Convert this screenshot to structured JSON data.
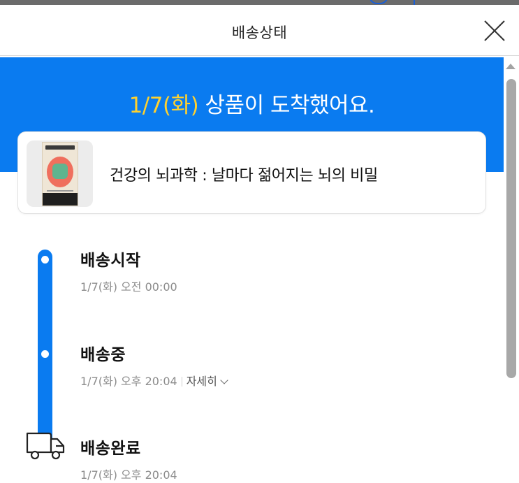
{
  "modal": {
    "title": "배송상태"
  },
  "banner": {
    "date": "1/7(화)",
    "message": " 상품이 도착했어요.",
    "colors": {
      "background": "#0a7bf0",
      "date": "#ffd12e",
      "text": "#ffffff"
    }
  },
  "product": {
    "name": "건강의 뇌과학 : 날마다 젊어지는 뇌의 비밀"
  },
  "timeline": {
    "steps": [
      {
        "label": "배송시작",
        "time": "1/7(화) 오전 00:00"
      },
      {
        "label": "배송중",
        "time": "1/7(화) 오후 20:04",
        "detail_label": "자세히"
      },
      {
        "label": "배송완료",
        "time": "1/7(화) 오후 20:04"
      }
    ],
    "accent_color": "#0a7bf0"
  },
  "icons": {
    "close": "close-icon",
    "truck": "truck-icon",
    "detail_chevron": "chevron-down-icon"
  }
}
